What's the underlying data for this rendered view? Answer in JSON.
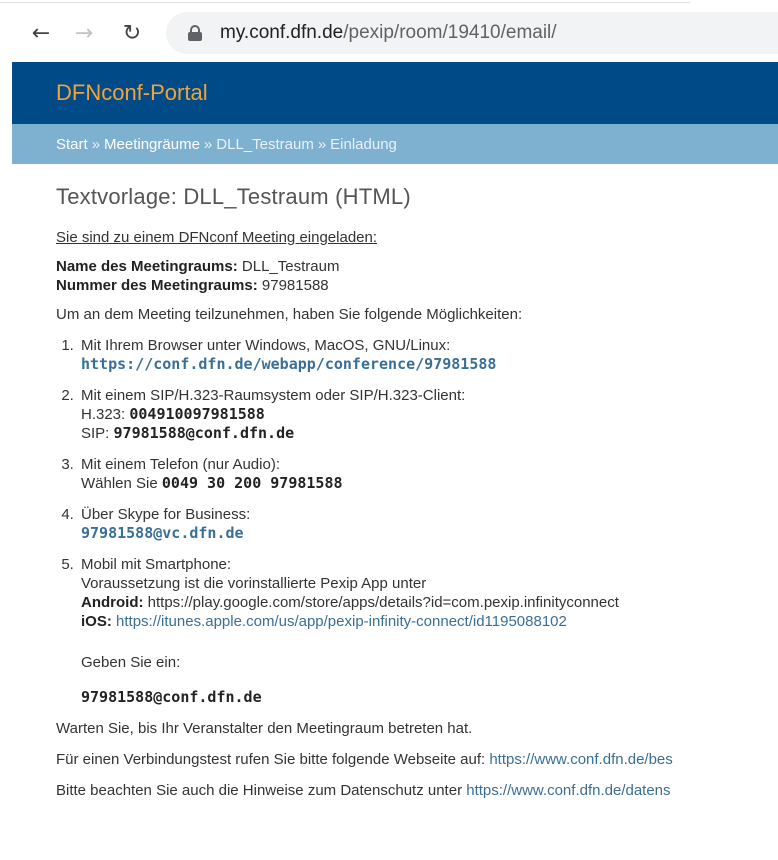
{
  "browser": {
    "url_host": "my.conf.dfn.de",
    "url_path": "/pexip/room/19410/email/"
  },
  "header": {
    "title": "DFNconf-Portal"
  },
  "breadcrumb": {
    "items": [
      "Start",
      "Meetingräume",
      "DLL_Testraum",
      "Einladung"
    ],
    "separator": "»"
  },
  "main": {
    "heading": "Textvorlage: DLL_Testraum (HTML)",
    "invite_line": "Sie sind zu einem DFNconf Meeting eingeladen:",
    "room_name_label": "Name des Meetingraums:",
    "room_name_value": "DLL_Testraum",
    "room_number_label": "Nummer des Meetingraums:",
    "room_number_value": "97981588",
    "options_intro": "Um an dem Meeting teilzunehmen, haben Sie folgende Möglichkeiten:",
    "options": {
      "browser": {
        "text": "Mit Ihrem Browser unter Windows, MacOS, GNU/Linux:",
        "link": "https://conf.dfn.de/webapp/conference/97981588"
      },
      "sip": {
        "text": "Mit einem SIP/H.323-Raumsystem oder SIP/H.323-Client:",
        "h323_label": "H.323:",
        "h323_value": "004910097981588",
        "sip_label": "SIP:",
        "sip_value": "97981588@conf.dfn.de"
      },
      "phone": {
        "text": "Mit einem Telefon (nur Audio):",
        "dial_label": "Wählen Sie",
        "dial_value": "0049 30 200 97981588"
      },
      "skype": {
        "text": "Über Skype for Business:",
        "link": "97981588@vc.dfn.de"
      },
      "mobile": {
        "text": "Mobil mit Smartphone:",
        "prereq": "Voraussetzung ist die vorinstallierte Pexip App unter",
        "android_label": "Android:",
        "android_link": "https://play.google.com/store/apps/details?id=com.pexip.infinityconnect",
        "ios_label": "iOS:",
        "ios_link": "https://itunes.apple.com/us/app/pexip-infinity-connect/id1195088102",
        "enter_label": "Geben Sie ein:",
        "enter_value": "97981588@conf.dfn.de"
      }
    },
    "wait_text": "Warten Sie, bis Ihr Veranstalter den Meetingraum betreten hat.",
    "test_text": "Für einen Verbindungstest rufen Sie bitte folgende Webseite auf:",
    "test_link": "https://www.conf.dfn.de/bes",
    "privacy_text": "Bitte beachten Sie auch die Hinweise zum Datenschutz unter",
    "privacy_link": "https://www.conf.dfn.de/datens"
  }
}
